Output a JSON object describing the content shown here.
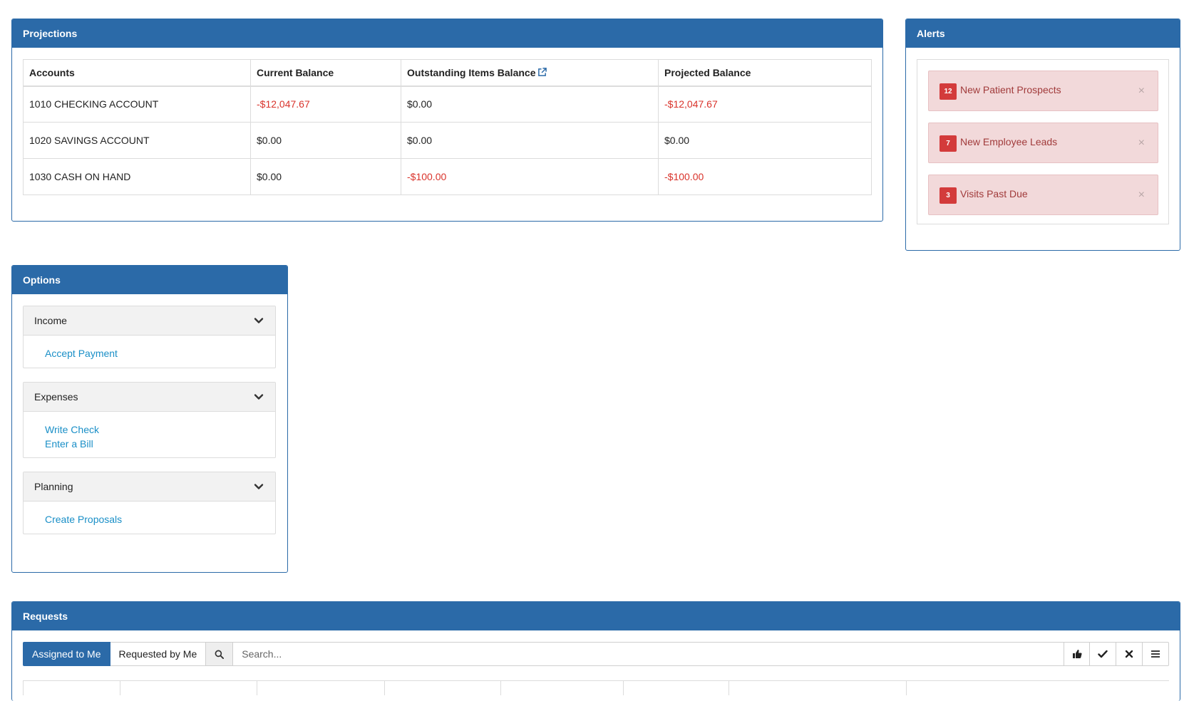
{
  "projections": {
    "title": "Projections",
    "columns": [
      "Accounts",
      "Current Balance",
      "Outstanding Items Balance",
      "Projected Balance"
    ],
    "rows": [
      {
        "account": "1010 CHECKING ACCOUNT",
        "current": "-$12,047.67",
        "outstanding": "$0.00",
        "projected": "-$12,047.67"
      },
      {
        "account": "1020 SAVINGS ACCOUNT",
        "current": "$0.00",
        "outstanding": "$0.00",
        "projected": "$0.00"
      },
      {
        "account": "1030 CASH ON HAND",
        "current": "$0.00",
        "outstanding": "-$100.00",
        "projected": "-$100.00"
      }
    ],
    "external_link_icon": "external-link-icon"
  },
  "alerts": {
    "title": "Alerts",
    "items": [
      {
        "count": "12",
        "label": "New Patient Prospects",
        "close": "×"
      },
      {
        "count": "7",
        "label": "New Employee Leads",
        "close": "×"
      },
      {
        "count": "3",
        "label": "Visits Past Due",
        "close": "×"
      }
    ]
  },
  "options": {
    "title": "Options",
    "sections": [
      {
        "label": "Income",
        "links": [
          "Accept Payment"
        ]
      },
      {
        "label": "Expenses",
        "links": [
          "Write Check",
          "Enter a Bill"
        ]
      },
      {
        "label": "Planning",
        "links": [
          "Create Proposals"
        ]
      }
    ]
  },
  "requests": {
    "title": "Requests",
    "tabs": [
      "Assigned to Me",
      "Requested by Me"
    ],
    "search_placeholder": "Search...",
    "action_icons": [
      "thumbs-up-icon",
      "check-icon",
      "close-icon",
      "menu-icon"
    ]
  },
  "colors": {
    "header_blue": "#2b6aa8",
    "negative_red": "#d9332b",
    "alert_bg": "#f2d9da",
    "badge_red": "#d33b3b",
    "link_blue": "#1a8fc7"
  }
}
